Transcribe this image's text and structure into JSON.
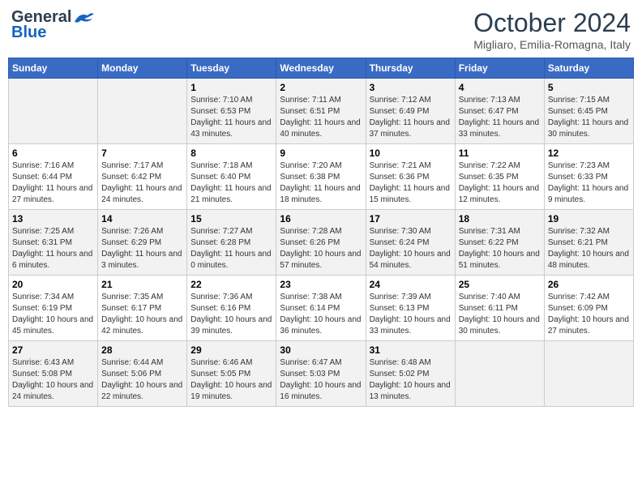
{
  "header": {
    "logo_general": "General",
    "logo_blue": "Blue",
    "month_title": "October 2024",
    "location": "Migliaro, Emilia-Romagna, Italy"
  },
  "weekdays": [
    "Sunday",
    "Monday",
    "Tuesday",
    "Wednesday",
    "Thursday",
    "Friday",
    "Saturday"
  ],
  "weeks": [
    [
      {
        "day": "",
        "info": ""
      },
      {
        "day": "",
        "info": ""
      },
      {
        "day": "1",
        "info": "Sunrise: 7:10 AM\nSunset: 6:53 PM\nDaylight: 11 hours and 43 minutes."
      },
      {
        "day": "2",
        "info": "Sunrise: 7:11 AM\nSunset: 6:51 PM\nDaylight: 11 hours and 40 minutes."
      },
      {
        "day": "3",
        "info": "Sunrise: 7:12 AM\nSunset: 6:49 PM\nDaylight: 11 hours and 37 minutes."
      },
      {
        "day": "4",
        "info": "Sunrise: 7:13 AM\nSunset: 6:47 PM\nDaylight: 11 hours and 33 minutes."
      },
      {
        "day": "5",
        "info": "Sunrise: 7:15 AM\nSunset: 6:45 PM\nDaylight: 11 hours and 30 minutes."
      }
    ],
    [
      {
        "day": "6",
        "info": "Sunrise: 7:16 AM\nSunset: 6:44 PM\nDaylight: 11 hours and 27 minutes."
      },
      {
        "day": "7",
        "info": "Sunrise: 7:17 AM\nSunset: 6:42 PM\nDaylight: 11 hours and 24 minutes."
      },
      {
        "day": "8",
        "info": "Sunrise: 7:18 AM\nSunset: 6:40 PM\nDaylight: 11 hours and 21 minutes."
      },
      {
        "day": "9",
        "info": "Sunrise: 7:20 AM\nSunset: 6:38 PM\nDaylight: 11 hours and 18 minutes."
      },
      {
        "day": "10",
        "info": "Sunrise: 7:21 AM\nSunset: 6:36 PM\nDaylight: 11 hours and 15 minutes."
      },
      {
        "day": "11",
        "info": "Sunrise: 7:22 AM\nSunset: 6:35 PM\nDaylight: 11 hours and 12 minutes."
      },
      {
        "day": "12",
        "info": "Sunrise: 7:23 AM\nSunset: 6:33 PM\nDaylight: 11 hours and 9 minutes."
      }
    ],
    [
      {
        "day": "13",
        "info": "Sunrise: 7:25 AM\nSunset: 6:31 PM\nDaylight: 11 hours and 6 minutes."
      },
      {
        "day": "14",
        "info": "Sunrise: 7:26 AM\nSunset: 6:29 PM\nDaylight: 11 hours and 3 minutes."
      },
      {
        "day": "15",
        "info": "Sunrise: 7:27 AM\nSunset: 6:28 PM\nDaylight: 11 hours and 0 minutes."
      },
      {
        "day": "16",
        "info": "Sunrise: 7:28 AM\nSunset: 6:26 PM\nDaylight: 10 hours and 57 minutes."
      },
      {
        "day": "17",
        "info": "Sunrise: 7:30 AM\nSunset: 6:24 PM\nDaylight: 10 hours and 54 minutes."
      },
      {
        "day": "18",
        "info": "Sunrise: 7:31 AM\nSunset: 6:22 PM\nDaylight: 10 hours and 51 minutes."
      },
      {
        "day": "19",
        "info": "Sunrise: 7:32 AM\nSunset: 6:21 PM\nDaylight: 10 hours and 48 minutes."
      }
    ],
    [
      {
        "day": "20",
        "info": "Sunrise: 7:34 AM\nSunset: 6:19 PM\nDaylight: 10 hours and 45 minutes."
      },
      {
        "day": "21",
        "info": "Sunrise: 7:35 AM\nSunset: 6:17 PM\nDaylight: 10 hours and 42 minutes."
      },
      {
        "day": "22",
        "info": "Sunrise: 7:36 AM\nSunset: 6:16 PM\nDaylight: 10 hours and 39 minutes."
      },
      {
        "day": "23",
        "info": "Sunrise: 7:38 AM\nSunset: 6:14 PM\nDaylight: 10 hours and 36 minutes."
      },
      {
        "day": "24",
        "info": "Sunrise: 7:39 AM\nSunset: 6:13 PM\nDaylight: 10 hours and 33 minutes."
      },
      {
        "day": "25",
        "info": "Sunrise: 7:40 AM\nSunset: 6:11 PM\nDaylight: 10 hours and 30 minutes."
      },
      {
        "day": "26",
        "info": "Sunrise: 7:42 AM\nSunset: 6:09 PM\nDaylight: 10 hours and 27 minutes."
      }
    ],
    [
      {
        "day": "27",
        "info": "Sunrise: 6:43 AM\nSunset: 5:08 PM\nDaylight: 10 hours and 24 minutes."
      },
      {
        "day": "28",
        "info": "Sunrise: 6:44 AM\nSunset: 5:06 PM\nDaylight: 10 hours and 22 minutes."
      },
      {
        "day": "29",
        "info": "Sunrise: 6:46 AM\nSunset: 5:05 PM\nDaylight: 10 hours and 19 minutes."
      },
      {
        "day": "30",
        "info": "Sunrise: 6:47 AM\nSunset: 5:03 PM\nDaylight: 10 hours and 16 minutes."
      },
      {
        "day": "31",
        "info": "Sunrise: 6:48 AM\nSunset: 5:02 PM\nDaylight: 10 hours and 13 minutes."
      },
      {
        "day": "",
        "info": ""
      },
      {
        "day": "",
        "info": ""
      }
    ]
  ]
}
